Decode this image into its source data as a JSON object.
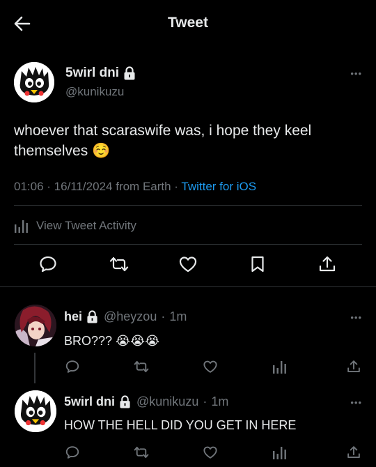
{
  "header": {
    "title": "Tweet",
    "back_icon": "arrow-left-icon"
  },
  "tweet": {
    "name": "5wirl dni",
    "handle": "@kunikuzu",
    "text": "whoever that scaraswife was, i hope they keel themselves ☺️",
    "time": "01:06",
    "date": "16/11/2024",
    "location": "from Earth",
    "source": "Twitter for iOS",
    "activity_label": "View Tweet Activity",
    "actions": [
      "reply-icon",
      "retweet-icon",
      "like-icon",
      "bookmark-icon",
      "share-icon"
    ]
  },
  "replies": [
    {
      "name": "hei",
      "handle": "@heyzou",
      "age": "1m",
      "text": "BRO??? 😭😭😭"
    },
    {
      "name": "5wirl dni",
      "handle": "@kunikuzu",
      "age": "1m",
      "text": "HOW THE HELL DID YOU GET IN HERE"
    }
  ],
  "colors": {
    "background": "#000000",
    "text": "#e7e9ea",
    "secondary": "#71767b",
    "link": "#1d9bf0",
    "divider": "#2f3336"
  }
}
